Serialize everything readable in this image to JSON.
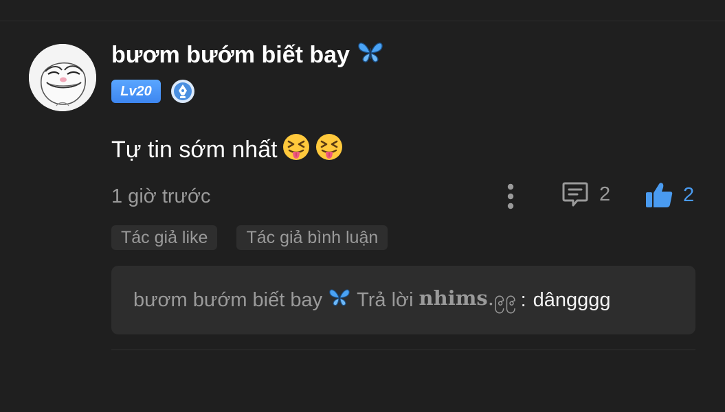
{
  "comment": {
    "username": "bươm bướm biết bay",
    "username_emoji": "butterfly-icon",
    "level_badge": "Lv20",
    "badge_icon": "pen-badge-icon",
    "text": "Tự tin sớm nhất",
    "emojis": [
      "squinting-tongue-face",
      "squinting-tongue-face"
    ],
    "timestamp": "1 giờ trước",
    "reply_count": "2",
    "like_count": "2",
    "tags": [
      "Tác giả like",
      "Tác giả bình luận"
    ]
  },
  "reply": {
    "author": "bươm bướm biết bay",
    "verb": "Trả lời",
    "target": "nhims.၉၉",
    "target_bold": "nhims",
    "target_rest": ".၉၉",
    "separator": ":",
    "content": "dângggg"
  },
  "colors": {
    "background": "#1f1f1f",
    "accent_blue": "#4a9bf0",
    "muted_text": "#9a9a9a",
    "reply_box": "#2d2d2d"
  }
}
